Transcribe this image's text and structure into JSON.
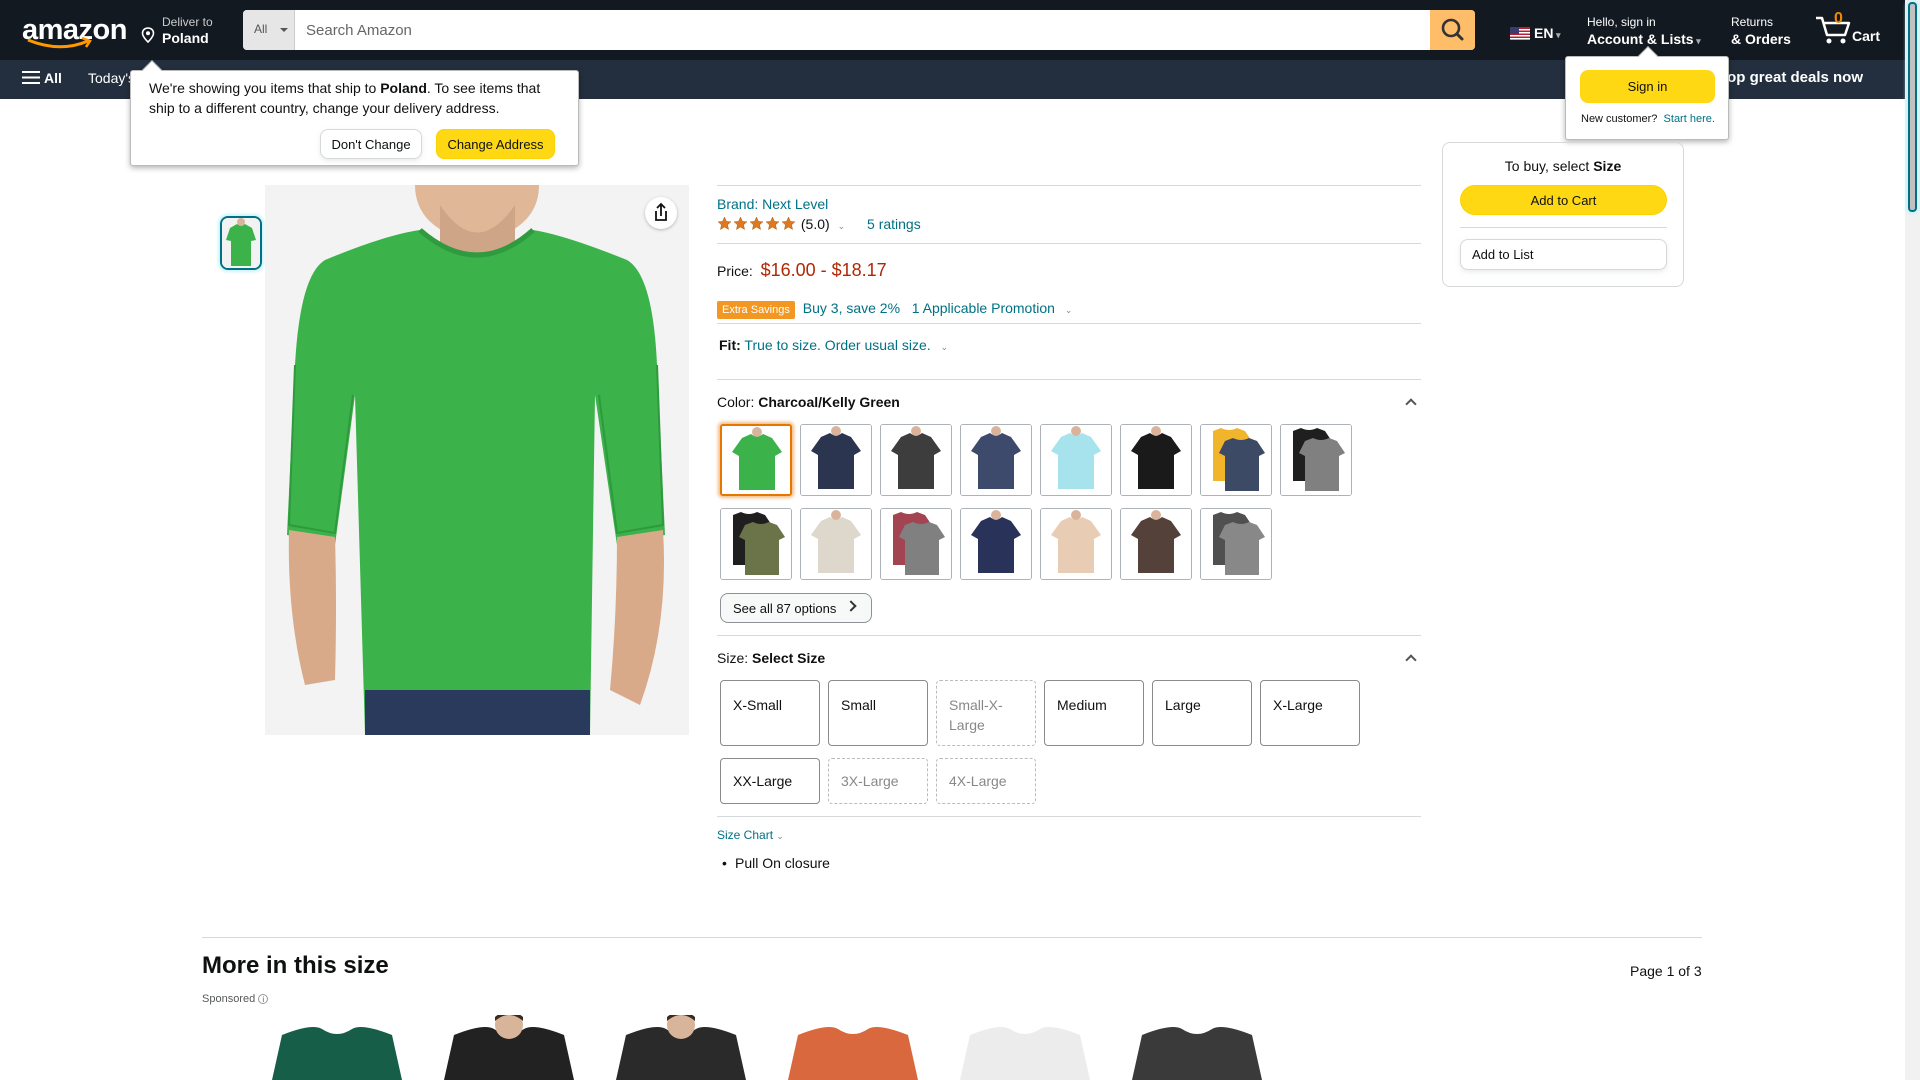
{
  "nav": {
    "logo": "amazon",
    "deliver_line1": "Deliver to",
    "deliver_line2": "Poland",
    "search_category": "All",
    "search_placeholder": "Search Amazon",
    "language": "EN",
    "account_line1": "Hello, sign in",
    "account_line2": "Account & Lists",
    "returns_line1": "Returns",
    "returns_line2": "& Orders",
    "cart_count": "0",
    "cart_label": "Cart"
  },
  "subnav": {
    "all_label": "All",
    "today_label": "Today's",
    "deals_label": "Shop great deals now"
  },
  "ship_popover": {
    "text_before": "We're showing you items that ship to ",
    "country": "Poland",
    "text_after": ". To see items that ship to a different country, change your delivery address.",
    "dont_change": "Don't Change",
    "change_address": "Change Address"
  },
  "signin_popover": {
    "signin_label": "Sign in",
    "new_customer": "New customer?",
    "start_here": "Start here."
  },
  "product": {
    "brand": "Brand: Next Level",
    "rating_value": "(5.0)",
    "rating_stars": 5,
    "ratings_count": "5 ratings",
    "price_label": "Price:",
    "price_low": "$16.00",
    "price_sep": " - ",
    "price_high": "$18.17",
    "promo_badge": "Extra Savings",
    "promo_text": "Buy 3, save 2%",
    "promo_link": "1 Applicable Promotion",
    "fit_label": "Fit:",
    "fit_text": "True to size. Order usual size.",
    "color_label": "Color:",
    "color_value": "Charcoal/Kelly Green",
    "see_all": "See all 87 options",
    "size_label": "Size:",
    "size_value": "Select Size",
    "sizes": [
      {
        "label": "X-Small",
        "available": true
      },
      {
        "label": "Small",
        "available": true
      },
      {
        "label": "Small-X-Large",
        "available": false
      },
      {
        "label": "Medium",
        "available": true
      },
      {
        "label": "Large",
        "available": true
      },
      {
        "label": "X-Large",
        "available": true
      },
      {
        "label": "XX-Large",
        "available": true
      },
      {
        "label": "3X-Large",
        "available": false
      },
      {
        "label": "4X-Large",
        "available": false
      }
    ],
    "size_chart": "Size Chart",
    "bullet": "Pull On closure"
  },
  "swatches": [
    {
      "name": "green",
      "color": "#3bb24a",
      "selected": true
    },
    {
      "name": "navy",
      "color": "#2c3550"
    },
    {
      "name": "charcoal",
      "color": "#3d3d3d"
    },
    {
      "name": "indigo",
      "color": "#3e4a6c"
    },
    {
      "name": "light-blue",
      "color": "#a6e3ec"
    },
    {
      "name": "black",
      "color": "#1a1a1a"
    },
    {
      "name": "multi-pack",
      "color": "#f0b52a",
      "color2": "#3d4a66"
    },
    {
      "name": "black-grey",
      "color": "#1f1f1f",
      "color2": "#808080"
    },
    {
      "name": "black-olive",
      "color": "#1f1f1f",
      "color2": "#6b7349"
    },
    {
      "name": "oatmeal",
      "color": "#ddd7cc"
    },
    {
      "name": "cardinal-grey",
      "color": "#a34453",
      "color2": "#808080"
    },
    {
      "name": "midnight-navy",
      "color": "#29335a"
    },
    {
      "name": "sand",
      "color": "#e8cdb4"
    },
    {
      "name": "brown",
      "color": "#54413a"
    },
    {
      "name": "charcoal-grey",
      "color": "#505050",
      "color2": "#888888"
    }
  ],
  "buybox": {
    "to_buy": "To buy, select ",
    "to_buy_bold": "Size",
    "add_to_cart": "Add to Cart",
    "add_to_list": "Add to List"
  },
  "more": {
    "title": "More in this size",
    "page": "Page 1 of 3",
    "sponsored": "Sponsored",
    "items": [
      {
        "name": "dark-green-tee",
        "color": "#175e48"
      },
      {
        "name": "black-tee-model",
        "color": "#222222"
      },
      {
        "name": "black-tee-model-2",
        "color": "#2a2a2a"
      },
      {
        "name": "tie-dye-tee",
        "color": "#d9683e"
      },
      {
        "name": "white-tee",
        "color": "#ececec"
      },
      {
        "name": "black-henley",
        "color": "#3a3a3a"
      }
    ]
  }
}
